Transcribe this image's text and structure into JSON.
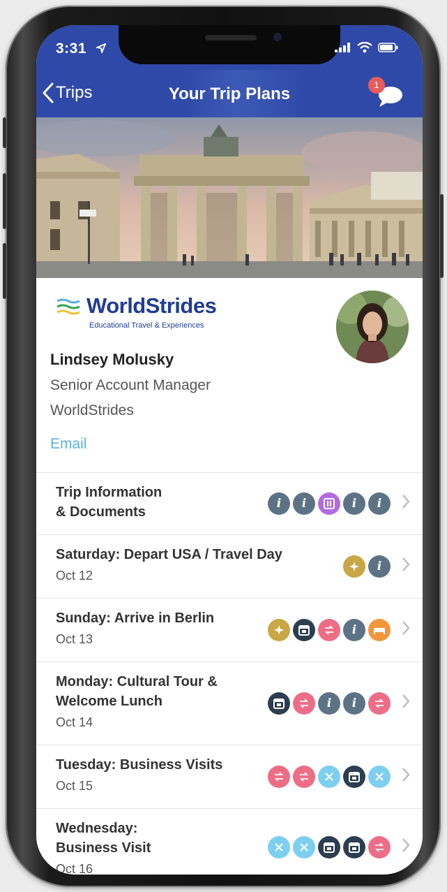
{
  "status": {
    "time": "3:31"
  },
  "nav": {
    "back_label": "Trips",
    "title": "Your Trip Plans",
    "badge_count": "1"
  },
  "contact": {
    "logo_word": "WorldStrides",
    "logo_tagline": "Educational Travel & Experiences",
    "name": "Lindsey Molusky",
    "title": "Senior Account Manager",
    "company": "WorldStrides",
    "email_label": "Email"
  },
  "colors": {
    "nav": "#2f49a8",
    "info": "#5d7385",
    "purple": "#b46ae0",
    "gold": "#c9a646",
    "dark": "#2c3e50",
    "pink": "#ee6d86",
    "orange": "#f2963b",
    "light_blue": "#7dcff0",
    "link": "#5ab0e0"
  },
  "rows": [
    {
      "title_lines": [
        "Trip Information",
        "& Documents"
      ],
      "date": "",
      "icons": [
        "info-icon",
        "info-icon",
        "document-icon",
        "info-icon",
        "info-icon"
      ]
    },
    {
      "title_lines": [
        "Saturday: Depart USA / Travel Day"
      ],
      "date": "Oct 12",
      "icons": [
        "flight-icon",
        "info-icon"
      ]
    },
    {
      "title_lines": [
        "Sunday: Arrive in Berlin"
      ],
      "date": "Oct 13",
      "icons": [
        "flight-icon",
        "calendar-icon",
        "transfer-icon",
        "info-icon",
        "hotel-icon"
      ]
    },
    {
      "title_lines": [
        "Monday: Cultural Tour &",
        "Welcome Lunch"
      ],
      "date": "Oct 14",
      "icons": [
        "calendar-icon",
        "transfer-icon",
        "info-icon",
        "info-icon",
        "transfer-icon"
      ]
    },
    {
      "title_lines": [
        "Tuesday: Business Visits"
      ],
      "date": "Oct 15",
      "icons": [
        "transfer-icon",
        "transfer-icon",
        "meal-icon",
        "calendar-icon",
        "meal-icon"
      ]
    },
    {
      "title_lines": [
        "Wednesday:",
        "Business Visit"
      ],
      "date": "Oct 16",
      "icons": [
        "meal-icon",
        "meal-icon",
        "calendar-icon",
        "calendar-icon",
        "transfer-icon"
      ]
    }
  ]
}
